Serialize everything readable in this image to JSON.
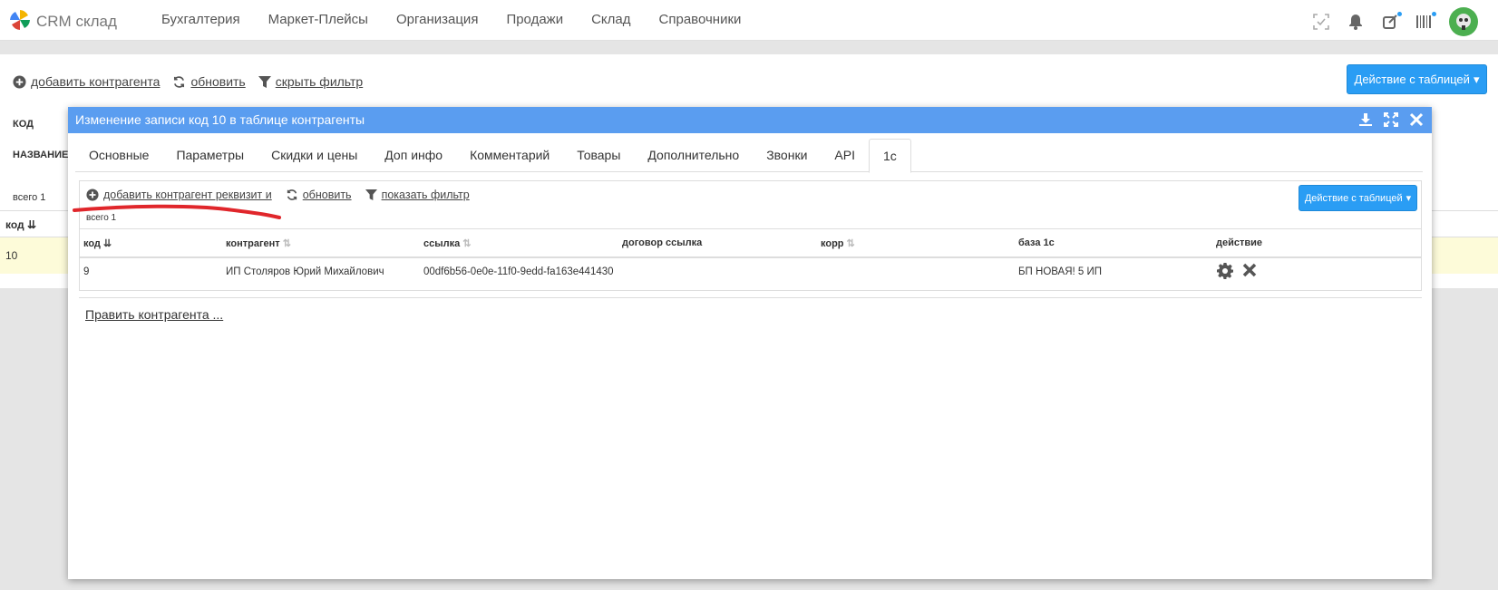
{
  "app": {
    "brand": "CRM склад"
  },
  "nav": [
    "Бухгалтерия",
    "Маркет-Плейсы",
    "Организация",
    "Продажи",
    "Склад",
    "Справочники"
  ],
  "page": {
    "toolbar": {
      "add": "добавить контрагента",
      "refresh": "обновить",
      "hide_filter": "скрыть фильтр"
    },
    "action_button": "Действие с таблицей",
    "filter_code": "КОД",
    "filter_name": "НАЗВАНИЕ",
    "total": "всего 1",
    "column_code": "код",
    "row_code": "10"
  },
  "modal": {
    "title": "Изменение записи код 10 в таблице контрагенты",
    "tabs": [
      "Основные",
      "Параметры",
      "Скидки и цены",
      "Доп инфо",
      "Комментарий",
      "Товары",
      "Дополнительно",
      "Звонки",
      "API",
      "1с"
    ],
    "active_tab": "1с",
    "toolbar": {
      "add": "добавить контрагент реквизит и",
      "refresh": "обновить",
      "show_filter": "показать фильтр"
    },
    "action_button": "Действие с таблицей",
    "total": "всего 1",
    "columns": [
      "код",
      "контрагент",
      "ссылка",
      "договор ссылка",
      "корр",
      "база 1с",
      "действие"
    ],
    "rows": [
      {
        "code": "9",
        "counterparty": "ИП Столяров Юрий Михайлович",
        "link": "00df6b56-0e0e-11f0-9edd-fa163e441430",
        "contract_link": "",
        "corr": "",
        "base": "БП НОВАЯ! 5 ИП"
      }
    ],
    "edit_link": "Править контрагента ..."
  },
  "colors": {
    "accent": "#2a9df4",
    "modal_header": "#5a9df0",
    "highlight_row": "#fdfbd9",
    "annotation": "#e0262b"
  }
}
